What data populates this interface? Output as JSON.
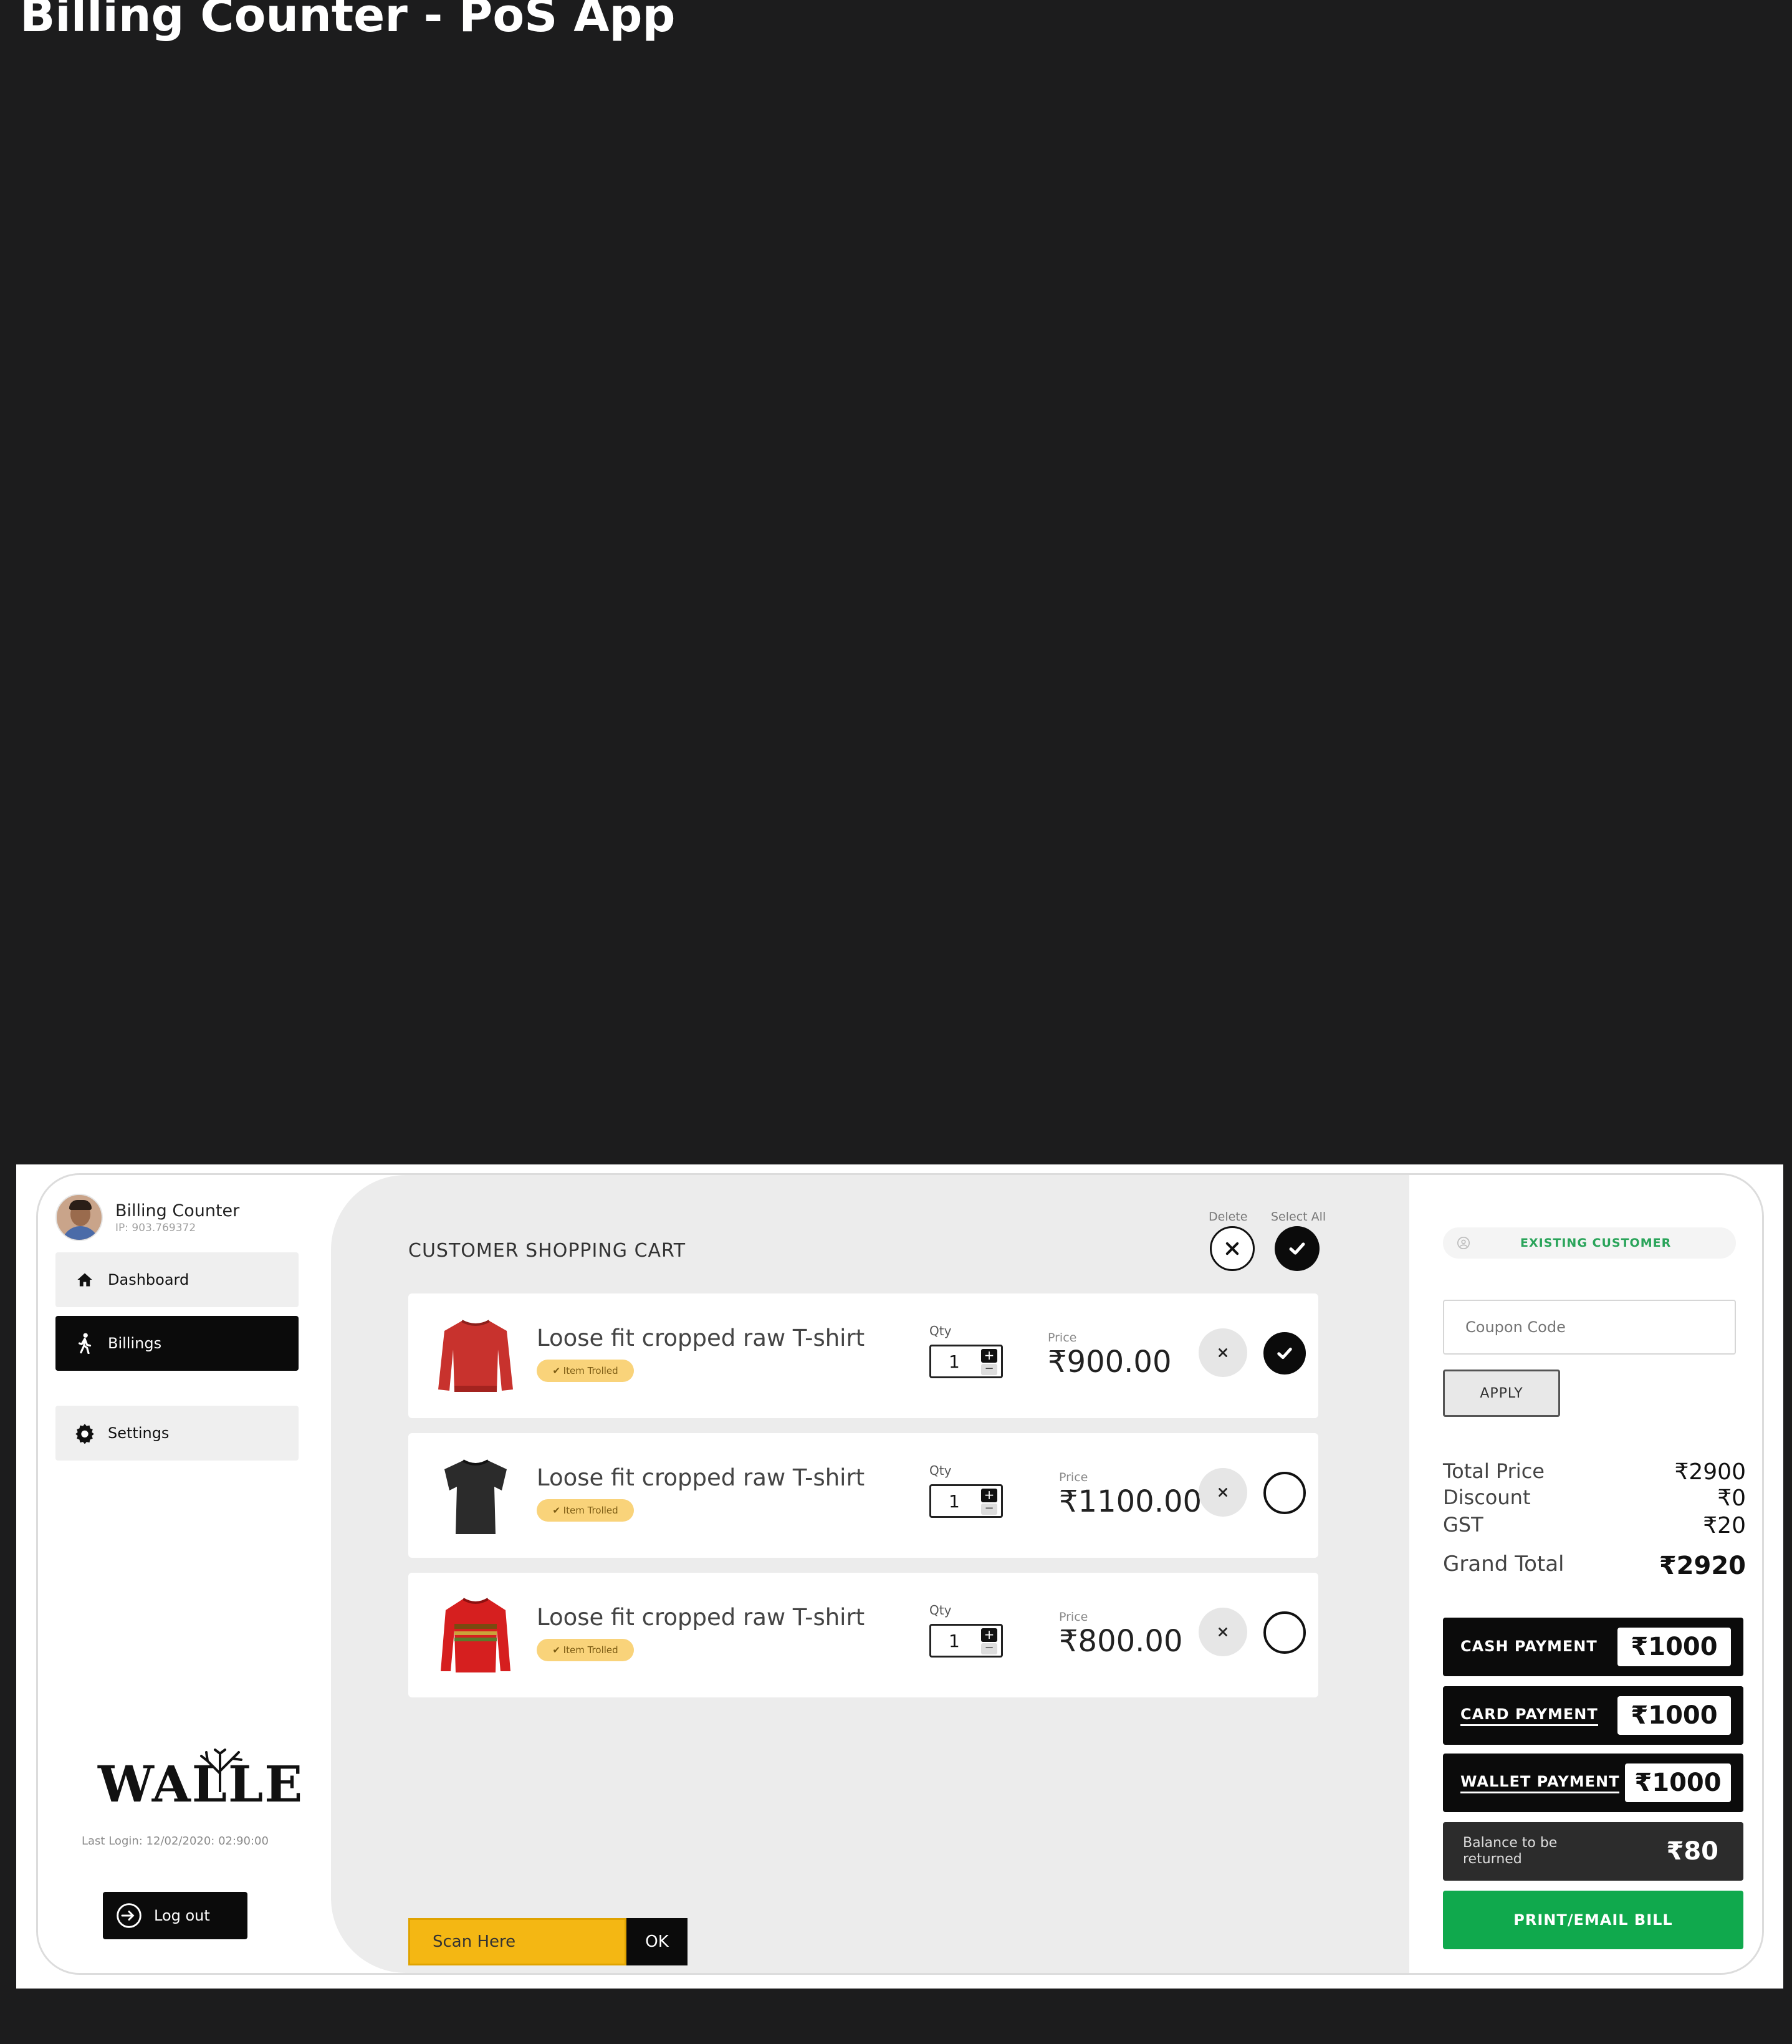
{
  "page": {
    "title": "Billing Counter - PoS App"
  },
  "sidebar": {
    "profile": {
      "name": "Billing Counter",
      "ip": "IP: 903.769372"
    },
    "items": [
      {
        "label": "Dashboard",
        "icon": "home-icon",
        "active": false
      },
      {
        "label": "Billings",
        "icon": "walking-person-icon",
        "active": true
      },
      {
        "label": "Settings",
        "icon": "gear-icon",
        "active": false
      }
    ],
    "logo": "WALLE",
    "last_login": "Last Login: 12/02/2020: 02:90:00",
    "logout_label": "Log out"
  },
  "cart": {
    "title": "CUSTOMER SHOPPING CART",
    "delete_label": "Delete",
    "select_all_label": "Select All",
    "items": [
      {
        "name": "Loose fit cropped raw T-shirt",
        "badge": "✔ Item Trolled",
        "qty_label": "Qty",
        "qty": "1",
        "price_label": "Price",
        "price": "₹900.00",
        "selected": true,
        "color": "#c8322d"
      },
      {
        "name": "Loose fit cropped raw T-shirt",
        "badge": "✔ Item Trolled",
        "qty_label": "Qty",
        "qty": "1",
        "price_label": "Price",
        "price": "₹1100.00",
        "selected": false,
        "color": "#2b2b2b"
      },
      {
        "name": "Loose fit cropped raw T-shirt",
        "badge": "✔ Item Trolled",
        "qty_label": "Qty",
        "qty": "1",
        "price_label": "Price",
        "price": "₹800.00",
        "selected": false,
        "color": "#d61f1f"
      }
    ],
    "scan": {
      "value": "Scan Here",
      "ok_label": "OK"
    }
  },
  "summary": {
    "customer_label": "EXISTING CUSTOMER",
    "coupon_placeholder": "Coupon Code",
    "apply_label": "APPLY",
    "total_price_label": "Total Price",
    "total_price": "₹2900",
    "discount_label": "Discount",
    "discount": "₹0",
    "gst_label": "GST",
    "gst": "₹20",
    "grand_total_label": "Grand Total",
    "grand_total": "₹2920",
    "payments": [
      {
        "label": "CASH PAYMENT",
        "amount": "₹1000"
      },
      {
        "label": "CARD PAYMENT",
        "amount": "₹1000"
      },
      {
        "label": "WALLET PAYMENT",
        "amount": "₹1000"
      }
    ],
    "balance_label": "Balance to be returned",
    "balance": "₹80",
    "print_label": "PRINT/EMAIL BILL"
  },
  "colors": {
    "accent_green": "#10a94d",
    "scan_yellow": "#f4b713",
    "dark": "#0b0b0b",
    "badge_yellow": "#f9d37a"
  }
}
